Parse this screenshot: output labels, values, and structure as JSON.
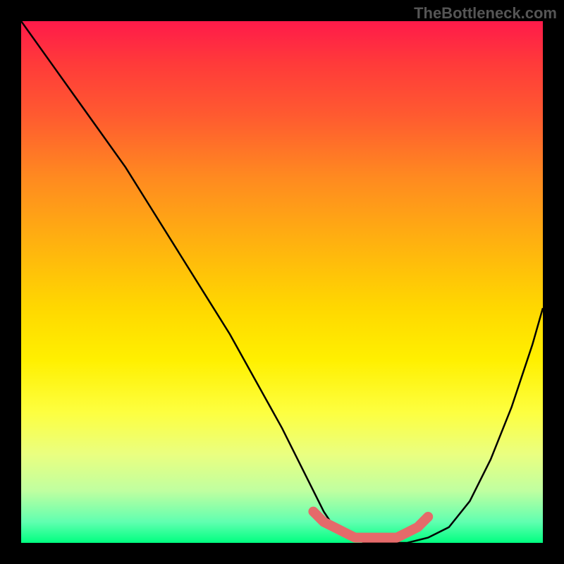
{
  "watermark": "TheBottleneck.com",
  "chart_data": {
    "type": "line",
    "title": "",
    "xlabel": "",
    "ylabel": "",
    "xlim": [
      0,
      100
    ],
    "ylim": [
      0,
      100
    ],
    "series": [
      {
        "name": "bottleneck-curve",
        "x": [
          0,
          5,
          10,
          15,
          20,
          25,
          30,
          35,
          40,
          45,
          50,
          55,
          58,
          60,
          63,
          66,
          70,
          74,
          78,
          82,
          86,
          90,
          94,
          98,
          100
        ],
        "y": [
          100,
          93,
          86,
          79,
          72,
          64,
          56,
          48,
          40,
          31,
          22,
          12,
          6,
          3,
          1,
          0,
          0,
          0,
          1,
          3,
          8,
          16,
          26,
          38,
          45
        ]
      },
      {
        "name": "optimal-range-marker",
        "x": [
          56,
          58,
          60,
          62,
          64,
          66,
          68,
          70,
          72,
          74,
          76,
          78
        ],
        "y": [
          6,
          4,
          3,
          2,
          1,
          1,
          1,
          1,
          1,
          2,
          3,
          5
        ]
      }
    ],
    "gradient_stops": [
      {
        "pos": 0,
        "color": "#ff1a4a"
      },
      {
        "pos": 8,
        "color": "#ff3a3a"
      },
      {
        "pos": 18,
        "color": "#ff5a30"
      },
      {
        "pos": 30,
        "color": "#ff8a20"
      },
      {
        "pos": 42,
        "color": "#ffb010"
      },
      {
        "pos": 55,
        "color": "#ffd800"
      },
      {
        "pos": 65,
        "color": "#fff000"
      },
      {
        "pos": 75,
        "color": "#fdff40"
      },
      {
        "pos": 83,
        "color": "#eaff80"
      },
      {
        "pos": 90,
        "color": "#c0ffa0"
      },
      {
        "pos": 96,
        "color": "#60ffb0"
      },
      {
        "pos": 100,
        "color": "#00ff80"
      }
    ]
  }
}
